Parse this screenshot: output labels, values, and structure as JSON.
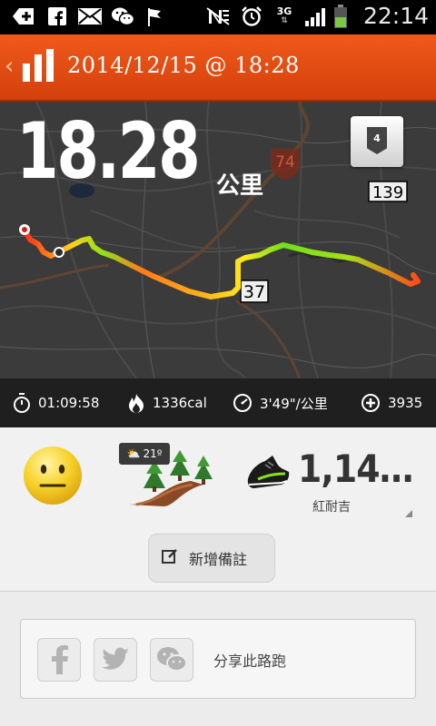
{
  "status_bar": {
    "time": "22:14",
    "network": "3G",
    "icons": [
      "add-icon",
      "facebook-icon",
      "mail-icon",
      "wechat-icon",
      "flag-icon",
      "signal-mute-icon",
      "alarm-icon",
      "signal-bars-icon",
      "battery-icon"
    ]
  },
  "header": {
    "title": "2014/12/15 @ 18:28",
    "back_icon": "chevron-left-icon",
    "logo_icon": "bar-chart-logo-icon"
  },
  "map": {
    "distance": "18.28",
    "unit": "公里",
    "badge_number": "4",
    "road_labels": [
      "74",
      "139",
      "37"
    ]
  },
  "stats": {
    "duration": "01:09:58",
    "calories": "1336cal",
    "pace": "3'49\"/公里",
    "fuel": "3935"
  },
  "run_info": {
    "mood_icon": "neutral-face-icon",
    "terrain_icon": "trail-icon",
    "temperature": "21º",
    "shoe_count": "1,14…",
    "shoe_name": "紅耐吉"
  },
  "note_button": {
    "label": "新增備註"
  },
  "share": {
    "label": "分享此路跑",
    "buttons": [
      "facebook-icon",
      "twitter-icon",
      "wechat-icon"
    ]
  },
  "colors": {
    "header": "#e8501a",
    "route_start": "#ff3a1a",
    "route_mid": "#ffd21a",
    "route_green": "#6be01a",
    "map_bg": "#3b3b3b"
  }
}
